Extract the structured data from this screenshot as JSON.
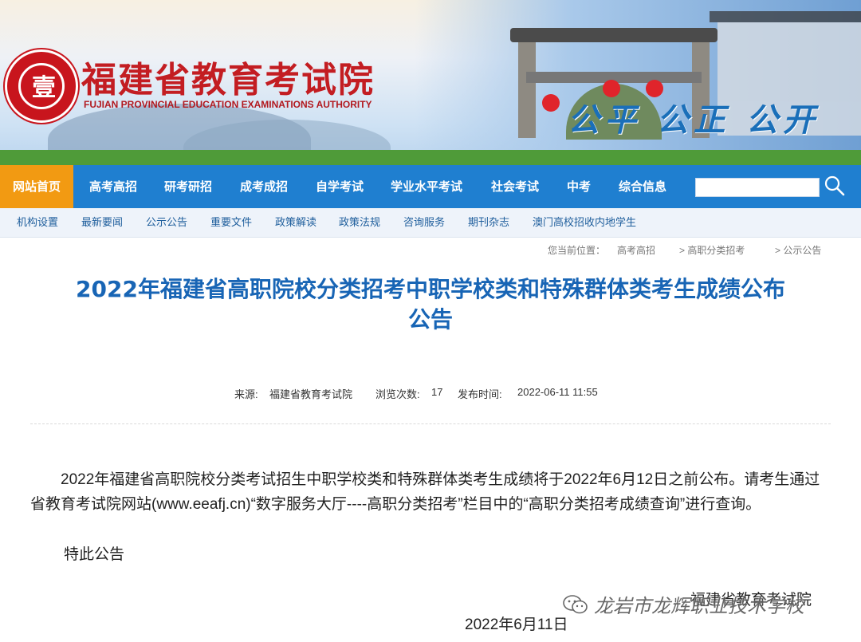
{
  "header": {
    "logo_glyph": "壹",
    "site_title": "福建省教育考试院",
    "site_subtitle": "FUJIAN PROVINCIAL EDUCATION EXAMINATIONS AUTHORITY",
    "slogan": "公平 公正 公开",
    "brand_red": "#c31d22",
    "brand_blue": "#1f7fd0"
  },
  "main_nav": {
    "items": [
      {
        "label": "网站首页",
        "active": true
      },
      {
        "label": "高考高招"
      },
      {
        "label": "研考研招"
      },
      {
        "label": "成考成招"
      },
      {
        "label": "自学考试"
      },
      {
        "label": "学业水平考试"
      },
      {
        "label": "社会考试"
      },
      {
        "label": "中考"
      },
      {
        "label": "综合信息"
      }
    ],
    "search_value": "",
    "search_icon": "search-icon",
    "active_color": "#f29a12"
  },
  "sub_nav": {
    "items": [
      "机构设置",
      "最新要闻",
      "公示公告",
      "重要文件",
      "政策解读",
      "政策法规",
      "咨询服务",
      "期刊杂志",
      "澳门高校招收内地学生"
    ]
  },
  "breadcrumb": {
    "prefix": "您当前位置：",
    "items": [
      "高考高招",
      "> 高职分类招考",
      "> 公示公告"
    ]
  },
  "article": {
    "title_line1": "2022年福建省高职院校分类招考中职学校类和特殊群体类考生成绩公布",
    "title_line2": "公告",
    "meta": {
      "source_label": "来源:",
      "source": "福建省教育考试院",
      "views_label": "浏览次数:",
      "views": "17",
      "date_label": "发布时间:",
      "date": "2022-06-11 11:55"
    },
    "paragraph": "2022年福建省高职院校分类考试招生中职学校类和特殊群体类考生成绩将于2022年6月12日之前公布。请考生通过省教育考试院网站(www.eeafj.cn)“数字服务大厅----高职分类招考”栏目中的“高职分类招考成绩查询”进行查询。",
    "closing": "特此公告",
    "signer": "福建省教育考试院",
    "sign_date": "2022年6月11日"
  },
  "watermark": {
    "icon": "wechat-icon",
    "text": "龙岩市龙辉职业技术学校"
  }
}
